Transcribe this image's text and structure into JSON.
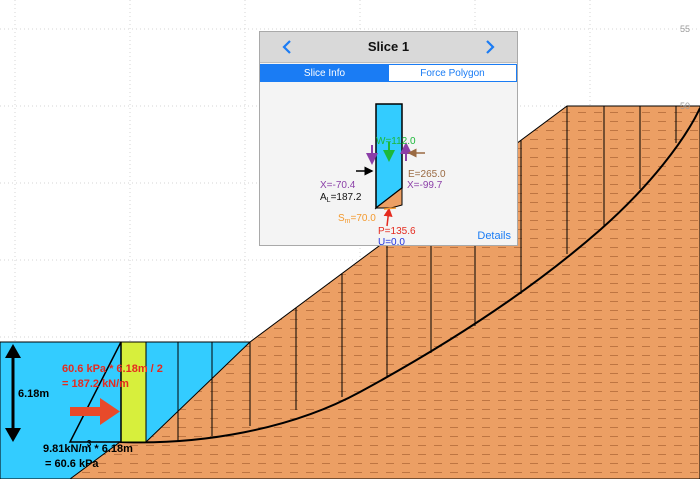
{
  "axis": {
    "tick_55": "55",
    "tick_50": "50"
  },
  "popup": {
    "title": "Slice 1",
    "tabs": [
      "Slice Info",
      "Force Polygon"
    ],
    "details_label": "Details",
    "forces": {
      "w_prefix": "W=",
      "w_value": "112.0",
      "e_label": "E=265.0",
      "x_left": "X=-70.4",
      "x_right": "X=-99.7",
      "al_prefix": "A",
      "al_sub": "L",
      "al_value": "=187.2",
      "sm_prefix": "S",
      "sm_sub": "m",
      "sm_value": "=70.0",
      "p_label": "P=135.6",
      "u_label": "U=0.0"
    }
  },
  "water": {
    "height_label": "6.18m",
    "pressure_line1": "60.6 kPa * 6.18m / 2",
    "pressure_line2": "= 187.2 kN/m",
    "unit_weight_line1": "9.81kN/m",
    "unit_weight_sup": "3",
    "unit_weight_line1b": " * 6.18m",
    "unit_weight_line2": "= 60.6 kPa"
  },
  "colors": {
    "soil": "#ec9f64",
    "water": "#33ccff",
    "highlight": "#d7ef3c",
    "accent": "#1a7cf4"
  }
}
